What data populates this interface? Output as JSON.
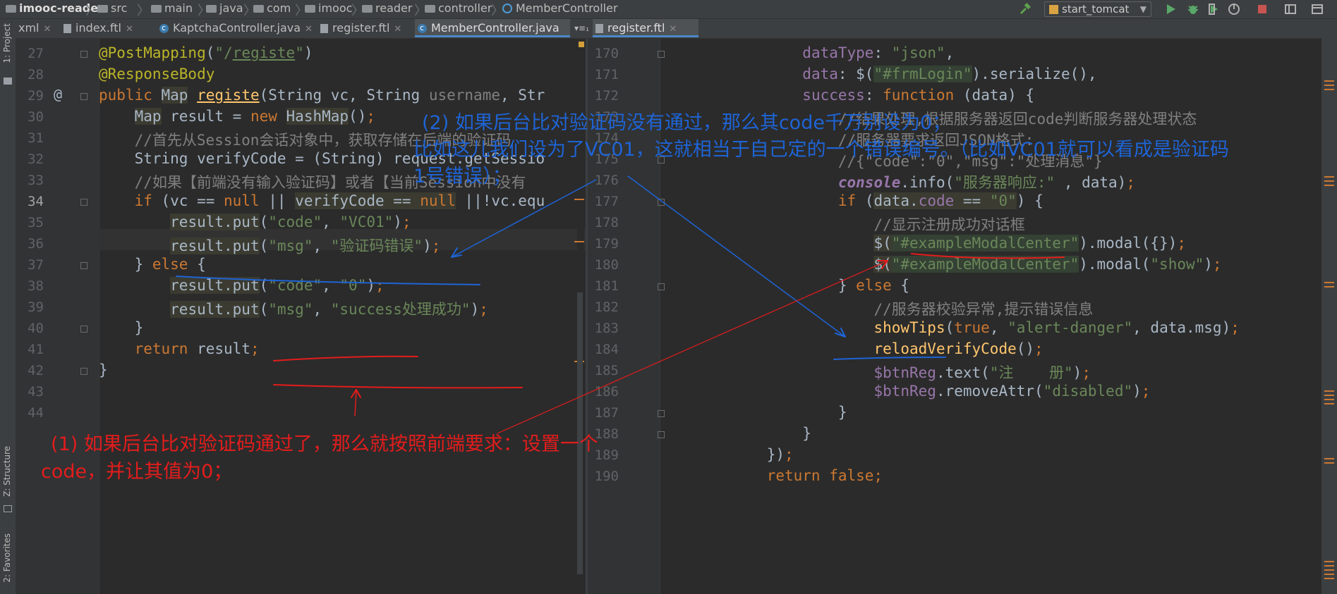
{
  "breadcrumb": {
    "project": "imooc-reader",
    "items": [
      "src",
      "main",
      "java",
      "com",
      "imooc",
      "reader",
      "controller"
    ],
    "class_name": "MemberController"
  },
  "toolbar": {
    "run_config": "start_tomcat",
    "icons": [
      "hammer-icon",
      "run-icon",
      "debug-icon",
      "coverage-icon",
      "profile-icon",
      "stop-icon",
      "layout-icon",
      "window-icon"
    ]
  },
  "tabs_left": [
    {
      "label": "xml",
      "icon": "file-icon"
    },
    {
      "label": "index.ftl",
      "icon": "file-icon"
    },
    {
      "label": "KaptchaController.java",
      "icon": "class-icon"
    },
    {
      "label": "register.ftl",
      "icon": "file-icon"
    },
    {
      "label": "MemberController.java",
      "icon": "class-icon",
      "active": true
    }
  ],
  "tab_overflow": "▾≡₁",
  "tabs_right": [
    {
      "label": "register.ftl",
      "icon": "file-icon",
      "active": true
    }
  ],
  "tool_windows": {
    "project": "1: Project",
    "structure": "Z: Structure",
    "favorites": "2: Favorites"
  },
  "left_editor": {
    "line_numbers": [
      "27",
      "28",
      "29",
      "30",
      "31",
      "32",
      "33",
      "34",
      "35",
      "36",
      "37",
      "38",
      "39",
      "40",
      "41",
      "42",
      "43",
      "44"
    ],
    "current_line": "34",
    "gutter_marker": "@"
  },
  "right_editor": {
    "line_numbers": [
      "170",
      "171",
      "172",
      "173",
      "174",
      "175",
      "176",
      "177",
      "178",
      "179",
      "180",
      "181",
      "182",
      "183",
      "184",
      "185",
      "186",
      "187",
      "188",
      "189",
      "190"
    ]
  },
  "annotations": {
    "blue_line1": "(2) 如果后台比对验证码没有通过，那么其code千万别设为0；",
    "blue_line2": "比如这儿我们设为了VC01，这就相当于自己定的一个错误编号。（比如VC01就可以看成是验证码",
    "blue_line3": "1号错误）；",
    "red_line1": "(1) 如果后台比对验证码通过了，那么就按照前端要求：设置一个",
    "red_line2": "code，并让其值为0；"
  },
  "colors": {
    "keyword": "#cc7832",
    "string": "#6a8759",
    "annotation": "#bbb529",
    "comment": "#808080",
    "function": "#ffc66d",
    "property": "#9876aa",
    "blue_note": "#1e64d6",
    "red_note": "#e41c1c"
  }
}
